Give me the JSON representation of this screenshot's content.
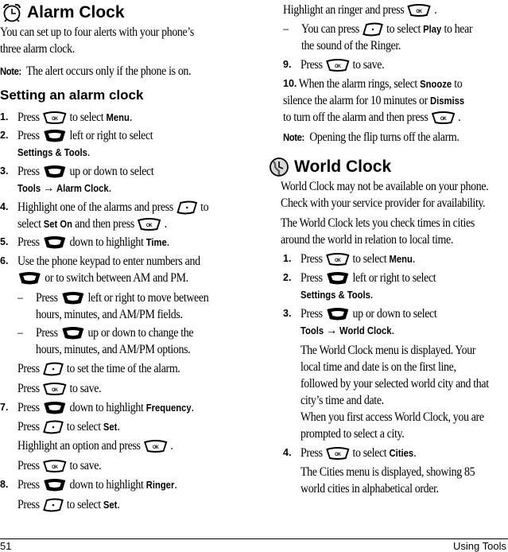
{
  "left": {
    "alarm_heading": "Alarm Clock",
    "intro_line1": "You can set up to four alerts with your phone’s",
    "intro_line2": "three alarm clock.",
    "note_label": "Note:",
    "note_text": "The alert occurs only if the phone is on.",
    "subheading": "Setting an alarm clock",
    "steps": [
      {
        "num": "1.",
        "pre": "Press",
        "key": "ok-key",
        "post": "to select",
        "bold": "Menu",
        "end": "."
      },
      {
        "num": "2.",
        "pre": "Press",
        "key": "nav-key",
        "post": "left or right to select",
        "bold_line2": "Settings & Tools",
        "end": "."
      },
      {
        "num": "3.",
        "pre": "Press",
        "key": "nav-key",
        "post": "up or down to select",
        "bold_line2a": "Tools",
        "arrow": "→",
        "bold_line2b": "Alarm Clock",
        "end": "."
      },
      {
        "num": "4.",
        "line1_pre": "Highlight one of the alarms and press",
        "key": "soft-key",
        "line1_post": "to",
        "line2_pre": "select",
        "bold": "Set On",
        "line2_mid": "and then press",
        "end": "."
      },
      {
        "num": "5.",
        "pre": "Press",
        "key": "nav-key",
        "post": "down to highlight",
        "bold": "Time",
        "end": "."
      },
      {
        "num": "6.",
        "line1": "Use the phone keypad to enter numbers and",
        "line2_post": "or to switch between AM and PM."
      }
    ],
    "sub_bullets": [
      {
        "dash": "–",
        "pre": "Press",
        "post": "left or right to move between",
        "line2": "hours, minutes, and AM/PM fields."
      },
      {
        "dash": "–",
        "pre": "Press",
        "post": "up or down to change the",
        "line2": "hours, minutes, and AM/PM options."
      }
    ],
    "step6_press_set": {
      "pre": "Press",
      "post": "to set the time of the alarm."
    },
    "step6_press_save": {
      "pre": "Press",
      "post": "to save."
    },
    "step7": {
      "num": "7.",
      "pre": "Press",
      "post": "down to highlight",
      "bold": "Frequency",
      "end": "."
    },
    "step7_set": {
      "pre": "Press",
      "post": "to select",
      "bold": "Set",
      "end": "."
    },
    "step7_highlight": {
      "pre": "Highlight an option and press",
      "end": "."
    },
    "step7_save": {
      "pre": "Press",
      "post": "to save."
    },
    "step8": {
      "num": "8.",
      "pre": "Press",
      "post": "down to highlight",
      "bold": "Ringer",
      "end": "."
    },
    "step8_set": {
      "pre": "Press",
      "post": "to select",
      "bold": "Set",
      "end": "."
    }
  },
  "right": {
    "ringer_highlight": {
      "pre": "Highlight an ringer and press",
      "end": "."
    },
    "ringer_bullet": {
      "dash": "–",
      "pre": "You can press",
      "post": "to select",
      "bold": "Play",
      "post2": "to hear",
      "line2": "the sound of the Ringer."
    },
    "step9": {
      "num": "9.",
      "pre": "Press",
      "post": "to save."
    },
    "step10": {
      "num": "10.",
      "line1_pre": "When the alarm rings, select",
      "bold1": "Snooze",
      "line1_post": "to",
      "line2_pre": "silence the alarm for 10 minutes or",
      "bold2": "Dismiss",
      "line3_pre": "to turn off the alarm and then press",
      "end": "."
    },
    "note_label": "Note:",
    "note_text": "Opening the flip turns off the alarm.",
    "world_heading": "World Clock",
    "world_p1_line1": "World Clock may not be available on your phone.",
    "world_p1_line2": "Check with your service provider for availability.",
    "world_p2_line1": "The World Clock lets you check times in cities",
    "world_p2_line2": "around the world in relation to local time.",
    "w_step1": {
      "num": "1.",
      "pre": "Press",
      "post": "to select",
      "bold": "Menu",
      "end": "."
    },
    "w_step2": {
      "num": "2.",
      "pre": "Press",
      "post": "left or right to select",
      "bold_line2": "Settings & Tools",
      "end": "."
    },
    "w_step3": {
      "num": "3.",
      "pre": "Press",
      "post": "up or down to select",
      "bold_line2a": "Tools",
      "arrow": "→",
      "bold_line2b": "World Clock",
      "end": "."
    },
    "w_step3_desc": [
      "The World Clock menu is displayed. Your",
      "local time and date is on the first line,",
      "followed by your selected world city and that",
      "city’s time and date."
    ],
    "w_step3_desc2": [
      "When you first access World Clock, you are",
      "prompted to select a city."
    ],
    "w_step4": {
      "num": "4.",
      "pre": "Press",
      "post": "to select",
      "bold": "Cities",
      "end": "."
    },
    "w_step4_desc": [
      "The Cities menu is displayed, showing 85",
      "world cities in alphabetical order."
    ]
  },
  "footer": {
    "page_number": "51",
    "section": "Using Tools"
  },
  "keys": {
    "ok_label": "OK"
  }
}
